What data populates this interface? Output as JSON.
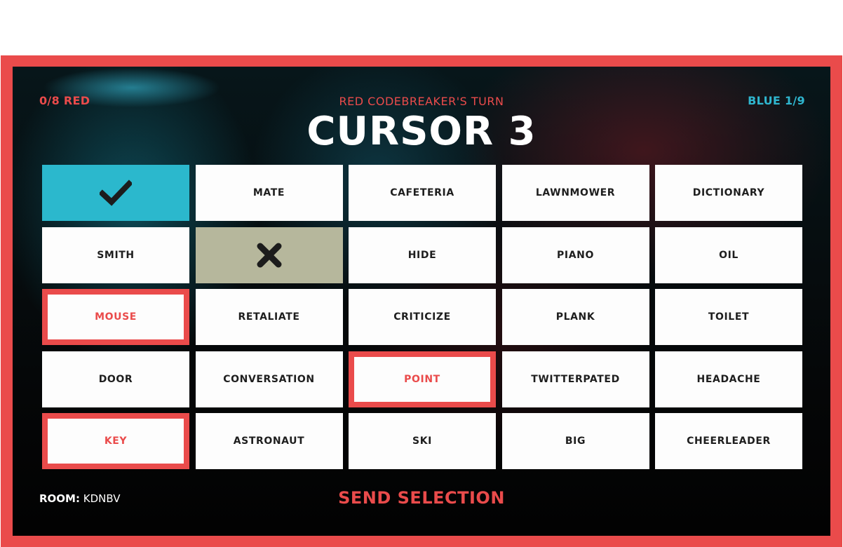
{
  "scores": {
    "red": "0/8 RED",
    "blue": "BLUE 1/9"
  },
  "turn": "RED CODEBREAKER'S TURN",
  "clue": "CURSOR 3",
  "colors": {
    "red": "#ea4b4b",
    "blue": "#2bb8cd",
    "neutral": "#b6b79c"
  },
  "cards": [
    {
      "word": "",
      "state": "blue-revealed",
      "icon": "check-icon"
    },
    {
      "word": "MATE",
      "state": "hidden"
    },
    {
      "word": "CAFETERIA",
      "state": "hidden"
    },
    {
      "word": "LAWNMOWER",
      "state": "hidden"
    },
    {
      "word": "DICTIONARY",
      "state": "hidden"
    },
    {
      "word": "SMITH",
      "state": "hidden"
    },
    {
      "word": "",
      "state": "neutral-revealed",
      "icon": "x-icon"
    },
    {
      "word": "HIDE",
      "state": "hidden"
    },
    {
      "word": "PIANO",
      "state": "hidden"
    },
    {
      "word": "OIL",
      "state": "hidden"
    },
    {
      "word": "MOUSE",
      "state": "selected"
    },
    {
      "word": "RETALIATE",
      "state": "hidden"
    },
    {
      "word": "CRITICIZE",
      "state": "hidden"
    },
    {
      "word": "PLANK",
      "state": "hidden"
    },
    {
      "word": "TOILET",
      "state": "hidden"
    },
    {
      "word": "DOOR",
      "state": "hidden"
    },
    {
      "word": "CONVERSATION",
      "state": "hidden"
    },
    {
      "word": "POINT",
      "state": "selected"
    },
    {
      "word": "TWITTERPATED",
      "state": "hidden"
    },
    {
      "word": "HEADACHE",
      "state": "hidden"
    },
    {
      "word": "KEY",
      "state": "selected"
    },
    {
      "word": "ASTRONAUT",
      "state": "hidden"
    },
    {
      "word": "SKI",
      "state": "hidden"
    },
    {
      "word": "BIG",
      "state": "hidden"
    },
    {
      "word": "CHEERLEADER",
      "state": "hidden"
    }
  ],
  "room": {
    "label": "ROOM:",
    "code": "KDNBV"
  },
  "send_label": "SEND SELECTION"
}
